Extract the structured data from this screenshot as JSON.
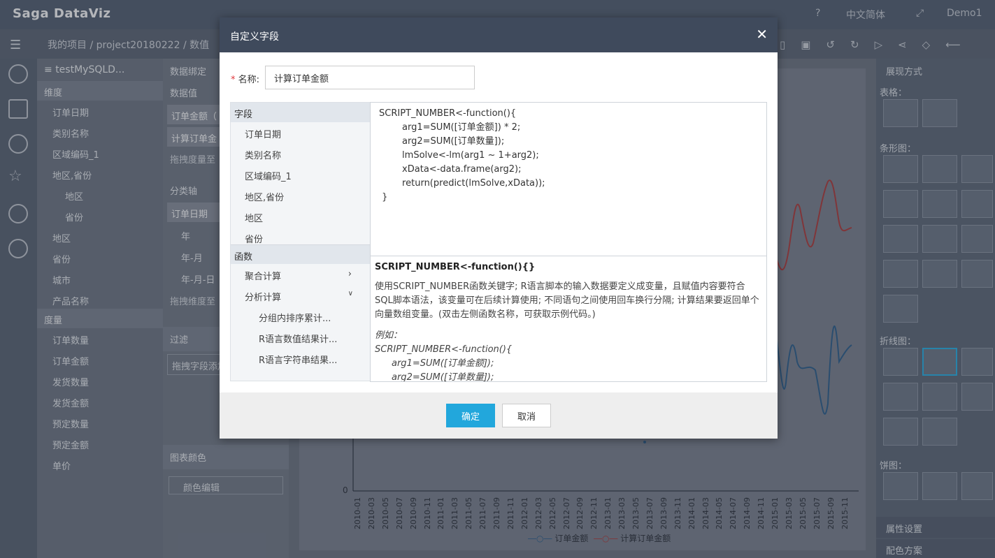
{
  "app": {
    "logo": "Saga DataViz",
    "lang": "中文简体",
    "user": "Demo1"
  },
  "breadcrumb": {
    "root": "我的项目",
    "project": "project20180222",
    "page": "数值"
  },
  "datasource": {
    "name": "testMySQLD..."
  },
  "dimension": {
    "header": "维度",
    "items": [
      "订单日期",
      "类别名称",
      "区域编码_1",
      "地区,省份",
      "地区",
      "省份",
      "地区",
      "省份",
      "城市",
      "产品名称"
    ]
  },
  "measure": {
    "header": "度量",
    "items": [
      "订单数量",
      "订单金额",
      "发货数量",
      "发货金额",
      "预定数量",
      "预定金额",
      "单价"
    ]
  },
  "binding": {
    "header": "数据绑定",
    "values_label": "数据值",
    "value_chips": [
      "订单金额（",
      "计算订单金"
    ],
    "drop_measure": "拖拽度量至",
    "category_label": "分类轴",
    "category_chip": "订单日期",
    "date_levels": [
      "年",
      "年-月",
      "年-月-日"
    ],
    "drop_dim": "拖拽维度至",
    "filter_label": "过滤",
    "filter_drop": "拖拽字段添加",
    "color_label": "图表颜色",
    "color_edit": "颜色编辑"
  },
  "right_panel": {
    "header": "展现方式",
    "table": "表格：",
    "bar": "条形图：",
    "line": "折线图：",
    "pie": "饼图：",
    "props": "属性设置",
    "scheme": "配色方案"
  },
  "chart": {
    "zero": "0",
    "legend": [
      "订单金额",
      "计算订单金额"
    ],
    "xticks": [
      "2010-01",
      "2010-03",
      "2010-05",
      "2010-07",
      "2010-09",
      "2010-11",
      "2011-01",
      "2011-03",
      "2011-05",
      "2011-07",
      "2011-09",
      "2011-11",
      "2012-01",
      "2012-03",
      "2012-05",
      "2012-07",
      "2012-09",
      "2012-11",
      "2013-01",
      "2013-03",
      "2013-05",
      "2013-07",
      "2013-09",
      "2013-11",
      "2014-01",
      "2014-03",
      "2014-05",
      "2014-07",
      "2014-09",
      "2014-11",
      "2015-01",
      "2015-03",
      "2015-05",
      "2015-07",
      "2015-09",
      "2015-11"
    ]
  },
  "dialog": {
    "title": "自定义字段",
    "name_label": "名称:",
    "name_value": "计算订单金额",
    "field_header": "字段",
    "fields": [
      "订单日期",
      "类别名称",
      "区域编码_1",
      "地区,省份",
      "地区",
      "省份"
    ],
    "func_header": "函数",
    "func_groups": [
      "聚合计算",
      "分析计算"
    ],
    "funcs": [
      "分组内排序累计...",
      "R语言数值结果计...",
      "R语言字符串结果..."
    ],
    "code": "SCRIPT_NUMBER<-function(){\n        arg1=SUM([订单金额]) * 2;\n        arg2=SUM([订单数量]);\n        lmSolve<-lm(arg1 ~ 1+arg2);\n        xData<-data.frame(arg2);\n        return(predict(lmSolve,xData));\n }",
    "desc_title": "SCRIPT_NUMBER<-function(){}",
    "desc_text": "使用SCRIPT_NUMBER函数关键字; R语言脚本的输入数据要定义成变量，且赋值内容要符合SQL脚本语法，该变量可在后续计算使用; 不同语句之间使用回车换行分隔; 计算结果要返回单个向量数组变量。(双击左侧函数名称，可获取示例代码。)",
    "example_label": "例如：",
    "example_lines": [
      "SCRIPT_NUMBER<-function(){",
      "arg1=SUM([订单金额]);",
      "arg2=SUM([订单数量]);"
    ],
    "ok": "确定",
    "cancel": "取消"
  }
}
